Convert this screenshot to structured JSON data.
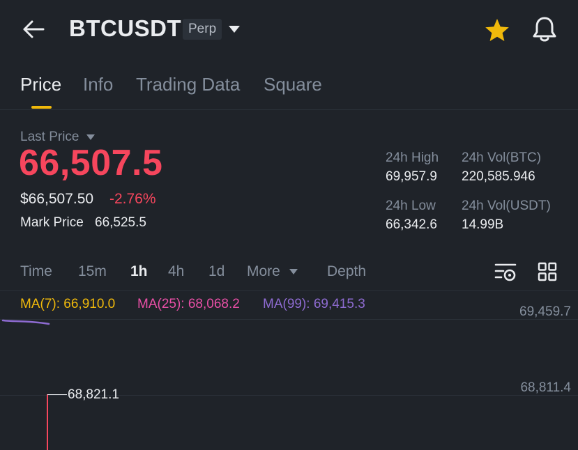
{
  "header": {
    "symbol": "BTCUSDT",
    "badge": "Perp",
    "back_icon": "arrow-left-icon",
    "dropdown_icon": "caret-down-icon",
    "favorite_icon": "star-icon",
    "alert_icon": "bell-icon"
  },
  "tabs": [
    {
      "label": "Price",
      "active": true
    },
    {
      "label": "Info",
      "active": false
    },
    {
      "label": "Trading Data",
      "active": false
    },
    {
      "label": "Square",
      "active": false
    }
  ],
  "price": {
    "last_price_label": "Last Price",
    "last_price": "66,507.5",
    "usd_price": "$66,507.50",
    "change_pct": "-2.76%",
    "mark_price_label": "Mark Price",
    "mark_price": "66,525.5"
  },
  "stats": {
    "high_label": "24h High",
    "high_value": "69,957.9",
    "vol_btc_label": "24h Vol(BTC)",
    "vol_btc_value": "220,585.946",
    "low_label": "24h Low",
    "low_value": "66,342.6",
    "vol_usdt_label": "24h Vol(USDT)",
    "vol_usdt_value": "14.99B"
  },
  "intervals": [
    {
      "label": "Time",
      "active": false
    },
    {
      "label": "15m",
      "active": false
    },
    {
      "label": "1h",
      "active": true
    },
    {
      "label": "4h",
      "active": false
    },
    {
      "label": "1d",
      "active": false
    },
    {
      "label": "More",
      "active": false
    },
    {
      "label": "Depth",
      "active": false
    }
  ],
  "chart": {
    "ma7": "MA(7): 66,910.0",
    "ma25": "MA(25): 68,068.2",
    "ma99": "MA(99): 69,415.3",
    "axis_top": "69,459.7",
    "axis_mid": "68,811.4",
    "high_marker": "68,821.1"
  },
  "colors": {
    "background": "#1f2329",
    "accent": "#f0b90b",
    "down": "#f6465d",
    "ma7": "#f0b90b",
    "ma25": "#e84fa6",
    "ma99": "#8e6bd1"
  }
}
